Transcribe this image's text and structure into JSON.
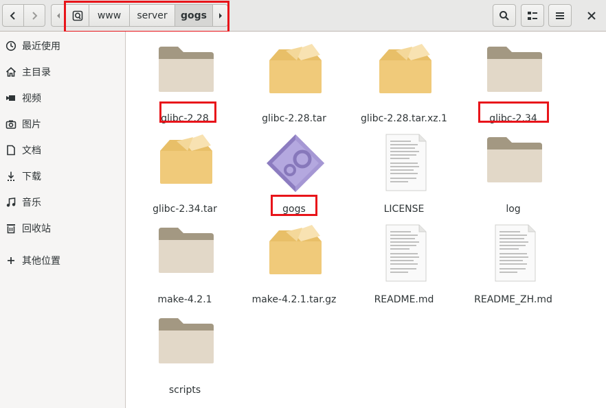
{
  "path_bar": {
    "crumbs": [
      "www",
      "server",
      "gogs"
    ],
    "active": "gogs"
  },
  "sidebar": {
    "items": [
      {
        "label": "最近使用",
        "icon": "recent-icon"
      },
      {
        "label": "主目录",
        "icon": "home-icon"
      },
      {
        "label": "视频",
        "icon": "video-icon"
      },
      {
        "label": "图片",
        "icon": "camera-icon"
      },
      {
        "label": "文档",
        "icon": "document-icon"
      },
      {
        "label": "下载",
        "icon": "download-icon"
      },
      {
        "label": "音乐",
        "icon": "music-icon"
      },
      {
        "label": "回收站",
        "icon": "trash-icon"
      },
      {
        "label": "其他位置",
        "icon": "plus-icon"
      }
    ]
  },
  "files": [
    {
      "name": "glibc-2.28",
      "type": "folder",
      "highlighted": true
    },
    {
      "name": "glibc-2.28.tar",
      "type": "archive",
      "highlighted": false
    },
    {
      "name": "glibc-2.28.tar.xz.1",
      "type": "archive",
      "highlighted": false
    },
    {
      "name": "glibc-2.34",
      "type": "folder",
      "highlighted": true
    },
    {
      "name": "glibc-2.34.tar",
      "type": "archive",
      "highlighted": false
    },
    {
      "name": "gogs",
      "type": "executable",
      "highlighted": true
    },
    {
      "name": "LICENSE",
      "type": "text",
      "highlighted": false
    },
    {
      "name": "log",
      "type": "folder",
      "highlighted": false
    },
    {
      "name": "make-4.2.1",
      "type": "folder",
      "highlighted": false
    },
    {
      "name": "make-4.2.1.tar.gz",
      "type": "archive",
      "highlighted": false
    },
    {
      "name": "README.md",
      "type": "text",
      "highlighted": false
    },
    {
      "name": "README_ZH.md",
      "type": "text",
      "highlighted": false
    },
    {
      "name": "scripts",
      "type": "folder",
      "highlighted": false
    }
  ],
  "colors": {
    "highlight": "#e8141a",
    "folder": "#d7cbb6",
    "archive": "#f2cf86"
  }
}
